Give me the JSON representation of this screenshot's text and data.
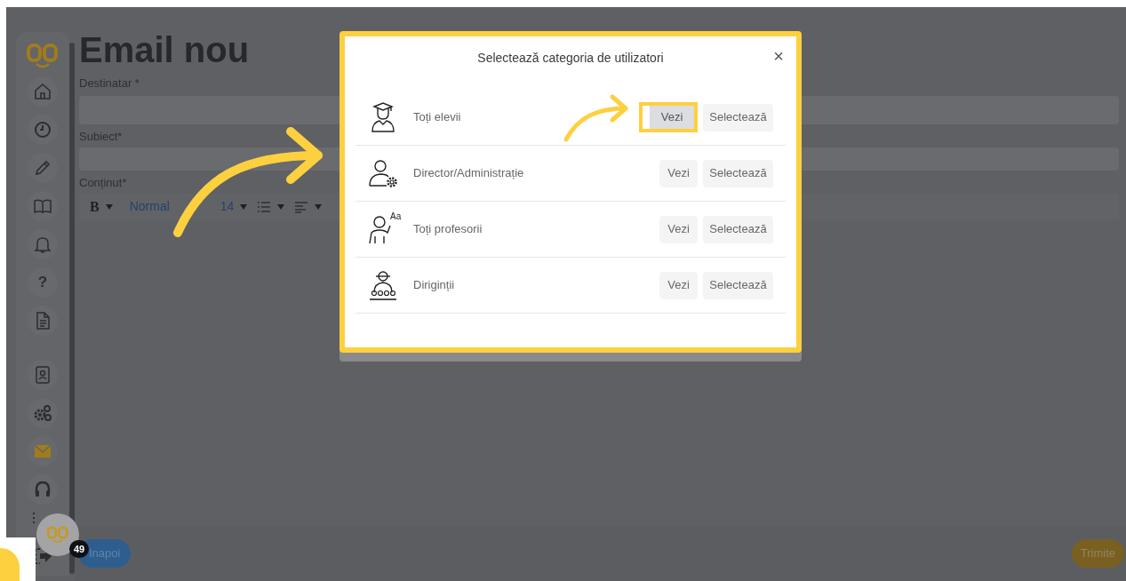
{
  "sidebar": {
    "items": [
      {
        "kind": "home",
        "selected": false
      },
      {
        "kind": "clock",
        "selected": false
      },
      {
        "kind": "pencil",
        "selected": false
      },
      {
        "kind": "book",
        "selected": false
      },
      {
        "kind": "bell",
        "selected": false
      },
      {
        "kind": "glyph",
        "text": "?",
        "selected": false
      },
      {
        "kind": "document",
        "selected": false
      },
      {
        "kind": "contact",
        "selected": false
      },
      {
        "kind": "gears",
        "selected": false
      },
      {
        "kind": "envelope",
        "selected": true
      },
      {
        "kind": "headphones",
        "selected": false
      }
    ]
  },
  "chat_bubble": {
    "badge": "49"
  },
  "page": {
    "title": "Email nou",
    "fields": [
      {
        "label": "Destinatar *"
      },
      {
        "label": "Subiect*"
      }
    ],
    "content_label": "Conținut*",
    "toolbar": {
      "bold": "B",
      "style": "Normal",
      "size": "14"
    }
  },
  "footer": {
    "back_button": "Inapoi",
    "send_button": "Trimite"
  },
  "modal": {
    "title": "Selectează categoria de utilizatori",
    "close": "×",
    "categories": [
      {
        "kind": "students",
        "label": "Toți elevii",
        "view": "Vezi",
        "select": "Selectează",
        "highlighted": true
      },
      {
        "kind": "admin",
        "label": "Director/Administrație",
        "view": "Vezi",
        "select": "Selectează",
        "highlighted": false
      },
      {
        "kind": "teachers",
        "icon_text": "Aa",
        "label": "Toți profesorii",
        "view": "Vezi",
        "select": "Selectează",
        "highlighted": false
      },
      {
        "kind": "form_teachers",
        "label": "Diriginții",
        "view": "Vezi",
        "select": "Selectează",
        "highlighted": false
      }
    ]
  }
}
